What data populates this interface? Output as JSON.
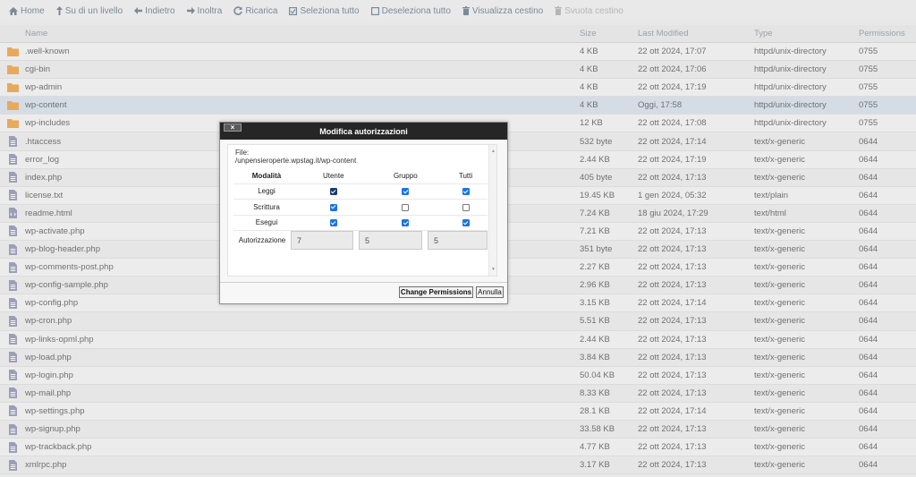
{
  "toolbar": {
    "items": [
      {
        "label": "Home",
        "icon": "home-icon",
        "enabled": true
      },
      {
        "label": "Su di un livello",
        "icon": "arrow-up-icon",
        "enabled": true
      },
      {
        "label": "Indietro",
        "icon": "arrow-left-icon",
        "enabled": true
      },
      {
        "label": "Inoltra",
        "icon": "arrow-right-icon",
        "enabled": true
      },
      {
        "label": "Ricarica",
        "icon": "refresh-icon",
        "enabled": true
      },
      {
        "label": "Seleziona tutto",
        "icon": "check-square-icon",
        "enabled": true
      },
      {
        "label": "Deseleziona tutto",
        "icon": "square-icon",
        "enabled": true
      },
      {
        "label": "Visualizza cestino",
        "icon": "trash-icon",
        "enabled": true
      },
      {
        "label": "Svuota cestino",
        "icon": "trash-icon",
        "enabled": false
      }
    ]
  },
  "table": {
    "headers": {
      "name": "Name",
      "size": "Size",
      "modified": "Last Modified",
      "type": "Type",
      "perms": "Permissions"
    },
    "rows": [
      {
        "name": ".well-known",
        "size": "4 KB",
        "modified": "22 ott 2024, 17:07",
        "type": "httpd/unix-directory",
        "perms": "0755",
        "kind": "folder"
      },
      {
        "name": "cgi-bin",
        "size": "4 KB",
        "modified": "22 ott 2024, 17:06",
        "type": "httpd/unix-directory",
        "perms": "0755",
        "kind": "folder"
      },
      {
        "name": "wp-admin",
        "size": "4 KB",
        "modified": "22 ott 2024, 17:19",
        "type": "httpd/unix-directory",
        "perms": "0755",
        "kind": "folder"
      },
      {
        "name": "wp-content",
        "size": "4 KB",
        "modified": "Oggi, 17:58",
        "type": "httpd/unix-directory",
        "perms": "0755",
        "kind": "folder",
        "selected": true
      },
      {
        "name": "wp-includes",
        "size": "12 KB",
        "modified": "22 ott 2024, 17:08",
        "type": "httpd/unix-directory",
        "perms": "0755",
        "kind": "folder"
      },
      {
        "name": ".htaccess",
        "size": "532 byte",
        "modified": "22 ott 2024, 17:14",
        "type": "text/x-generic",
        "perms": "0644",
        "kind": "file"
      },
      {
        "name": "error_log",
        "size": "2.44 KB",
        "modified": "22 ott 2024, 17:19",
        "type": "text/x-generic",
        "perms": "0644",
        "kind": "file"
      },
      {
        "name": "index.php",
        "size": "405 byte",
        "modified": "22 ott 2024, 17:13",
        "type": "text/x-generic",
        "perms": "0644",
        "kind": "file"
      },
      {
        "name": "license.txt",
        "size": "19.45 KB",
        "modified": "1 gen 2024, 05:32",
        "type": "text/plain",
        "perms": "0644",
        "kind": "file"
      },
      {
        "name": "readme.html",
        "size": "7.24 KB",
        "modified": "18 giu 2024, 17:29",
        "type": "text/html",
        "perms": "0644",
        "kind": "html"
      },
      {
        "name": "wp-activate.php",
        "size": "7.21 KB",
        "modified": "22 ott 2024, 17:13",
        "type": "text/x-generic",
        "perms": "0644",
        "kind": "file"
      },
      {
        "name": "wp-blog-header.php",
        "size": "351 byte",
        "modified": "22 ott 2024, 17:13",
        "type": "text/x-generic",
        "perms": "0644",
        "kind": "file"
      },
      {
        "name": "wp-comments-post.php",
        "size": "2.27 KB",
        "modified": "22 ott 2024, 17:13",
        "type": "text/x-generic",
        "perms": "0644",
        "kind": "file"
      },
      {
        "name": "wp-config-sample.php",
        "size": "2.96 KB",
        "modified": "22 ott 2024, 17:13",
        "type": "text/x-generic",
        "perms": "0644",
        "kind": "file"
      },
      {
        "name": "wp-config.php",
        "size": "3.15 KB",
        "modified": "22 ott 2024, 17:14",
        "type": "text/x-generic",
        "perms": "0644",
        "kind": "file"
      },
      {
        "name": "wp-cron.php",
        "size": "5.51 KB",
        "modified": "22 ott 2024, 17:13",
        "type": "text/x-generic",
        "perms": "0644",
        "kind": "file"
      },
      {
        "name": "wp-links-opml.php",
        "size": "2.44 KB",
        "modified": "22 ott 2024, 17:13",
        "type": "text/x-generic",
        "perms": "0644",
        "kind": "file"
      },
      {
        "name": "wp-load.php",
        "size": "3.84 KB",
        "modified": "22 ott 2024, 17:13",
        "type": "text/x-generic",
        "perms": "0644",
        "kind": "file"
      },
      {
        "name": "wp-login.php",
        "size": "50.04 KB",
        "modified": "22 ott 2024, 17:13",
        "type": "text/x-generic",
        "perms": "0644",
        "kind": "file"
      },
      {
        "name": "wp-mail.php",
        "size": "8.33 KB",
        "modified": "22 ott 2024, 17:13",
        "type": "text/x-generic",
        "perms": "0644",
        "kind": "file"
      },
      {
        "name": "wp-settings.php",
        "size": "28.1 KB",
        "modified": "22 ott 2024, 17:14",
        "type": "text/x-generic",
        "perms": "0644",
        "kind": "file"
      },
      {
        "name": "wp-signup.php",
        "size": "33.58 KB",
        "modified": "22 ott 2024, 17:13",
        "type": "text/x-generic",
        "perms": "0644",
        "kind": "file"
      },
      {
        "name": "wp-trackback.php",
        "size": "4.77 KB",
        "modified": "22 ott 2024, 17:13",
        "type": "text/x-generic",
        "perms": "0644",
        "kind": "file"
      },
      {
        "name": "xmlrpc.php",
        "size": "3.17 KB",
        "modified": "22 ott 2024, 17:13",
        "type": "text/x-generic",
        "perms": "0644",
        "kind": "file"
      }
    ]
  },
  "dialog": {
    "title": "Modifica autorizzazioni",
    "close_label": "×",
    "file_prefix": "File:",
    "file_path": "/unpensieroperte.wpstag.it/wp-content",
    "col_mode": "Modalità",
    "col_user": "Utente",
    "col_group": "Gruppo",
    "col_all": "Tutti",
    "row_read": "Leggi",
    "row_write": "Scrittura",
    "row_exec": "Esegui",
    "auth_label": "Autorizzazione",
    "user_value": "7",
    "group_value": "5",
    "all_value": "5",
    "change_button": "Change Permissions",
    "cancel_button": "Annulla",
    "perms": {
      "read": [
        true,
        true,
        true
      ],
      "write": [
        true,
        false,
        false
      ],
      "exec": [
        true,
        true,
        true
      ]
    }
  },
  "colors": {
    "folder": "#e9a95a",
    "file": "#9a9fb5",
    "dialog_title_bg": "#262626",
    "checkbox": "#1a73e8"
  }
}
